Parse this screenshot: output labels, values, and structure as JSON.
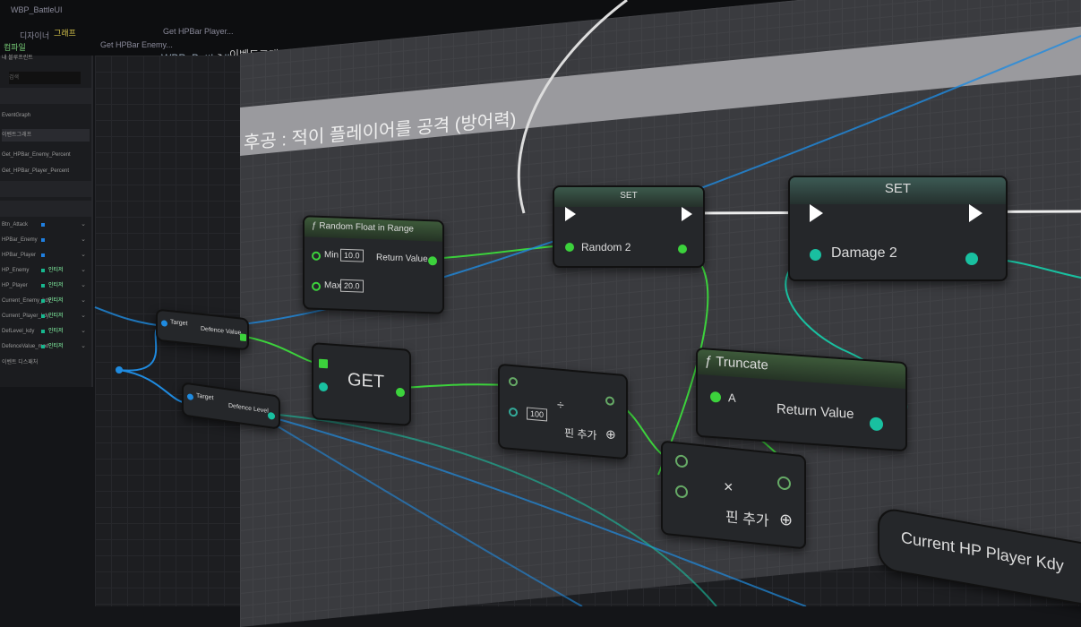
{
  "tabs": {
    "asset": "WBP_BattleUI",
    "designer": "디자이너",
    "graph": "그래프"
  },
  "function_tabs": [
    "Get HPBar Enemy...",
    "Get HPBar Player..."
  ],
  "toolbar": {
    "compile": "컴파일"
  },
  "breadcrumb": {
    "root": "WBP_BattleUI",
    "separator": ">",
    "current": "이벤트그래프"
  },
  "left_panel": {
    "title": "내 블루프린트",
    "search_placeholder": "검색",
    "graphs": [
      "EventGraph",
      "이벤트그래프"
    ],
    "functions": [
      "Get_HPBar_Enemy_Percent",
      "Get_HPBar_Player_Percent"
    ],
    "variables": [
      {
        "name": "Btn_Attack",
        "type": "",
        "color": "#1f7fe0"
      },
      {
        "name": "HPBar_Enemy",
        "type": "",
        "color": "#1f7fe0"
      },
      {
        "name": "HPBar_Player",
        "type": "",
        "color": "#1f7fe0"
      },
      {
        "name": "HP_Enemy",
        "type": "인티저",
        "color": "#17b88f"
      },
      {
        "name": "HP_Player",
        "type": "인티저",
        "color": "#17b88f"
      },
      {
        "name": "Current_Enemy_kdy",
        "type": "인티저",
        "color": "#17b88f"
      },
      {
        "name": "Current_Player_kdy",
        "type": "인티저",
        "color": "#17b88f"
      },
      {
        "name": "DefLevel_kdy",
        "type": "인티저",
        "color": "#17b88f"
      },
      {
        "name": "DefenceValue_mod",
        "type": "인티저",
        "color": "#17b88f"
      }
    ],
    "footer": "이벤트 디스패처"
  },
  "comment": "후공 : 적이 플레이어를 공격 (방어력)",
  "nodes": {
    "random_float": {
      "title": "Random Float in Range",
      "min_label": "Min",
      "min": "10.0",
      "max_label": "Max",
      "max": "20.0",
      "out": "Return Value"
    },
    "set1": {
      "title": "SET",
      "var": "Random 2"
    },
    "set2": {
      "title": "SET",
      "var": "Damage 2"
    },
    "get_def_value": {
      "target": "Target",
      "out": "Defence Value"
    },
    "get_def_level": {
      "target": "Target",
      "out": "Defence Level"
    },
    "get": {
      "title": "GET"
    },
    "divide": {
      "symbol": "÷",
      "value": "100",
      "add_pin": "핀 추가"
    },
    "truncate": {
      "title": "Truncate",
      "in": "A",
      "out": "Return Value"
    },
    "multiply": {
      "symbol": "×",
      "add_pin": "핀 추가"
    },
    "current_hp": {
      "title": "Current HP Player Kdy"
    }
  }
}
